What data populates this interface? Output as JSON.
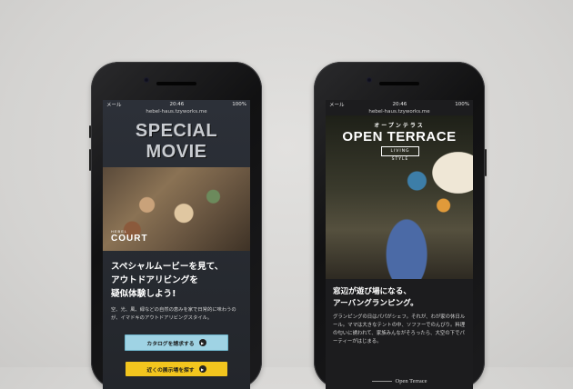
{
  "left_phone": {
    "status": {
      "carrier": "メール",
      "time": "20:46",
      "battery": "100%"
    },
    "url": "hebel-haus.tzyworks.me",
    "title": "SPECIAL MOVIE",
    "photo_logo_small": "HEBEL",
    "photo_logo": "COURT",
    "headline": [
      "スペシャルムービーを見て、",
      "アウトドアリビングを",
      "疑似体験しよう!"
    ],
    "body": "空、光、風、緑などの自然の恵みを家で日常的に味わうのが、イマドキのアウトドアリビングスタイル。",
    "buttons": [
      {
        "label": "カタログを請求する",
        "icon": "play-icon"
      },
      {
        "label": "近くの展示場を探す",
        "icon": "play-icon"
      }
    ]
  },
  "right_phone": {
    "status": {
      "carrier": "メール",
      "time": "20:46",
      "battery": "100%"
    },
    "url": "hebel-haus.tzyworks.me",
    "subtitle": "オープンテラス",
    "title": "OPEN TERRACE",
    "badge": "LIVING STYLE",
    "headline": [
      "窓辺が遊び場になる、",
      "アーバングランピング。"
    ],
    "body": "グランピングの日はパパがシェフ。それが、わが家の休日ルール。ママは大きなテントの中、ソファーでのんびり。料理の匂いに誘われて、家族みんながそろったら、大空の下でパーティーがはじまる。",
    "footer": "Open Terrace"
  }
}
